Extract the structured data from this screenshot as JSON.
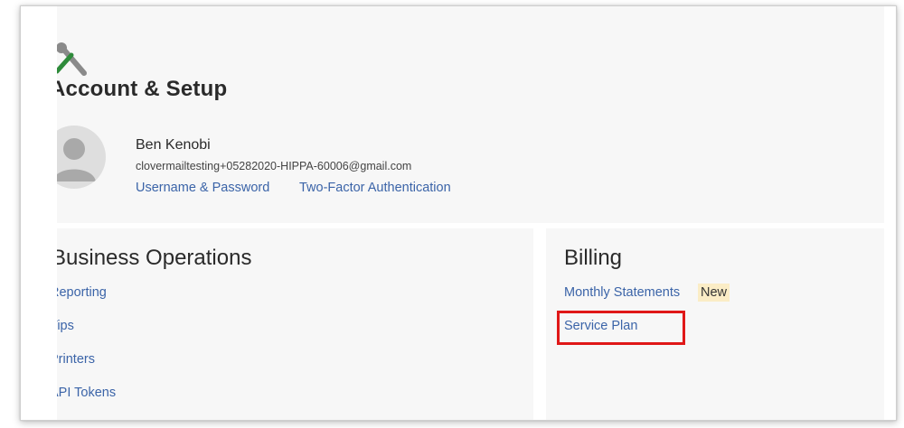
{
  "header": {
    "title": "Account & Setup",
    "icon": "tools-icon"
  },
  "profile": {
    "name": "Ben Kenobi",
    "email": "clovermailtesting+05282020-HIPPA-60006@gmail.com",
    "links": {
      "username_password": "Username & Password",
      "two_factor": "Two-Factor Authentication"
    }
  },
  "business_operations": {
    "title": "Business Operations",
    "items": [
      "Reporting",
      "Tips",
      "Printers",
      "API Tokens"
    ]
  },
  "billing": {
    "title": "Billing",
    "monthly_statements": "Monthly Statements",
    "new_badge": "New",
    "service_plan": "Service Plan",
    "highlight_color": "#e01818"
  },
  "colors": {
    "link": "#3b64a8",
    "badge_bg": "#fbedc6",
    "background": "#f7f7f7"
  }
}
